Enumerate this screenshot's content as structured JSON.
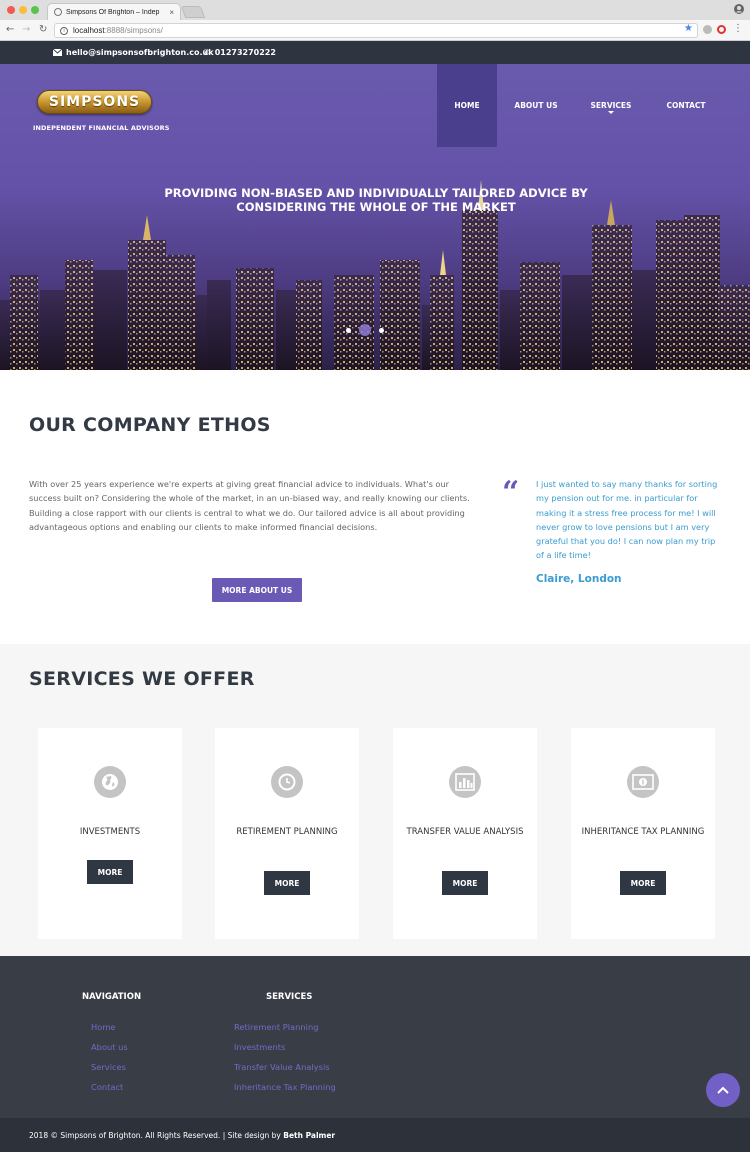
{
  "browser": {
    "tab_title": "Simpsons Of Brighton – Indep",
    "tab_close": "×",
    "url_host": "localhost",
    "url_path": ":8888/simpsons/"
  },
  "topbar": {
    "email": "hello@simpsonsofbrighton.co.uk",
    "phone": "01273270222"
  },
  "header": {
    "logo_text": "SIMPSONS",
    "tagline": "INDEPENDENT FINANCIAL ADVISORS",
    "nav": [
      "HOME",
      "ABOUT US",
      "SERVICES",
      "CONTACT"
    ]
  },
  "hero": {
    "heading": "PROVIDING NON-BIASED AND INDIVIDUALLY TAILORED ADVICE BY CONSIDERING THE WHOLE OF THE MARKET",
    "slide_count": 3,
    "active_slide": 2
  },
  "ethos": {
    "title": "OUR COMPANY ETHOS",
    "body": "With over 25 years experience we're experts at giving great financial advice to individuals. What's our success built on? Considering the whole of the market, in an un-biased way, and really knowing our clients. Building a close rapport with our clients is central to what we do. Our tailored advice is all about providing advantageous options and enabling our clients to make informed financial decisions.",
    "button": "MORE ABOUT US",
    "quote": "I just wanted to say many thanks for sorting my pension out for me. in particular for making it a stress free process for me!  I will never grow to love pensions but I am very grateful that you do! I can now plan my trip of a life time!",
    "quote_author": "Claire, London"
  },
  "services": {
    "title": "SERVICES WE OFFER",
    "cards": [
      {
        "title": "INVESTMENTS",
        "button": "MORE",
        "icon": "globe-icon"
      },
      {
        "title": "RETIREMENT PLANNING",
        "button": "MORE",
        "icon": "clock-icon"
      },
      {
        "title": "TRANSFER VALUE ANALYSIS",
        "button": "MORE",
        "icon": "bar-chart-icon"
      },
      {
        "title": "INHERITANCE TAX PLANNING",
        "button": "MORE",
        "icon": "money-icon"
      }
    ]
  },
  "footer": {
    "nav_heading": "NAVIGATION",
    "nav_links": [
      "Home",
      "About us",
      "Services",
      "Contact"
    ],
    "services_heading": "SERVICES",
    "services_links": [
      "Retirement Planning",
      "Investments",
      "Transfer Value Analysis",
      "Inheritance Tax Planning"
    ],
    "copyright": "2018 © Simpsons of Brighton. All Rights Reserved.  | Site design by",
    "designer": "Beth Palmer"
  },
  "colors": {
    "brand_purple": "#6a59b5",
    "quote_blue": "#3b9ccf",
    "dark": "#2f3742"
  }
}
